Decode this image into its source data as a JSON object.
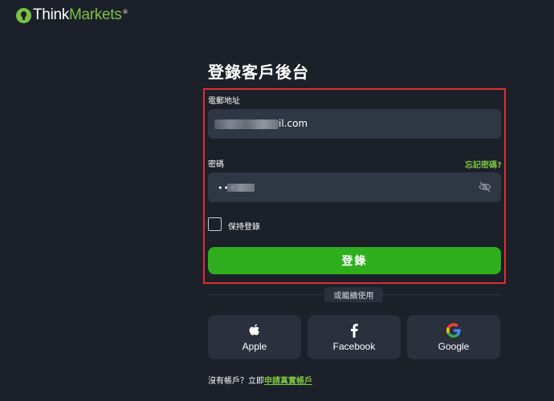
{
  "logo": {
    "think": "Think",
    "markets": "Markets",
    "reg": "®"
  },
  "title": "登錄客戶後台",
  "form": {
    "email_label": "電郵地址",
    "email_value": "il.com",
    "password_label": "密碼",
    "password_value": "•••",
    "forgot_password": "忘記密碼?",
    "remember_me": "保持登錄",
    "login_button": "登錄"
  },
  "divider_text": "或繼續使用",
  "social": [
    {
      "label": "Apple",
      "icon": "apple-icon"
    },
    {
      "label": "Facebook",
      "icon": "facebook-icon"
    },
    {
      "label": "Google",
      "icon": "google-icon"
    }
  ],
  "signup": {
    "prompt": "沒有帳戶？立即",
    "link": "申請真實帳戶"
  },
  "colors": {
    "background": "#1c2029",
    "input_bg": "#2f3644",
    "accent_green": "#7cc142",
    "button_green": "#2fae1e",
    "highlight_red": "#e02d2d"
  }
}
